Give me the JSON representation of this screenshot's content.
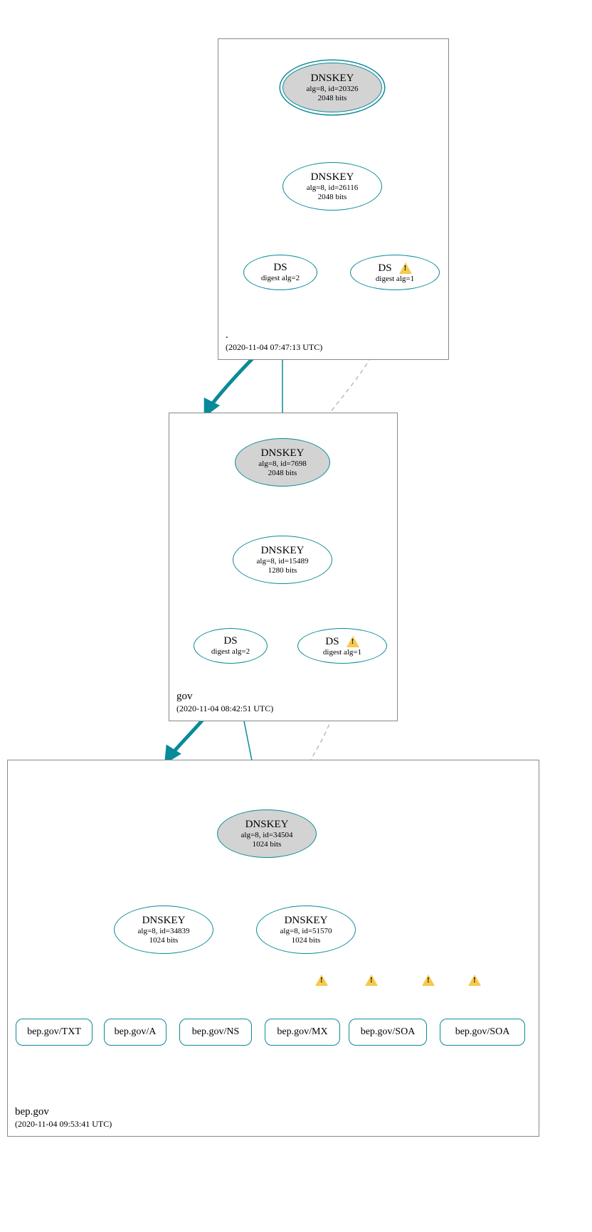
{
  "zones": {
    "root": {
      "name": ".",
      "timestamp": "(2020-11-04 07:47:13 UTC)"
    },
    "gov": {
      "name": "gov",
      "timestamp": "(2020-11-04 08:42:51 UTC)"
    },
    "bep": {
      "name": "bep.gov",
      "timestamp": "(2020-11-04 09:53:41 UTC)"
    }
  },
  "nodes": {
    "root_ksk": {
      "title": "DNSKEY",
      "line1": "alg=8, id=20326",
      "line2": "2048 bits"
    },
    "root_zsk": {
      "title": "DNSKEY",
      "line1": "alg=8, id=26116",
      "line2": "2048 bits"
    },
    "root_ds2": {
      "title": "DS",
      "line1": "digest alg=2"
    },
    "root_ds1": {
      "title": "DS",
      "line1": "digest alg=1"
    },
    "gov_ksk": {
      "title": "DNSKEY",
      "line1": "alg=8, id=7698",
      "line2": "2048 bits"
    },
    "gov_zsk": {
      "title": "DNSKEY",
      "line1": "alg=8, id=15489",
      "line2": "1280 bits"
    },
    "gov_ds2": {
      "title": "DS",
      "line1": "digest alg=2"
    },
    "gov_ds1": {
      "title": "DS",
      "line1": "digest alg=1"
    },
    "bep_ksk": {
      "title": "DNSKEY",
      "line1": "alg=8, id=34504",
      "line2": "1024 bits"
    },
    "bep_zsk1": {
      "title": "DNSKEY",
      "line1": "alg=8, id=34839",
      "line2": "1024 bits"
    },
    "bep_zsk2": {
      "title": "DNSKEY",
      "line1": "alg=8, id=51570",
      "line2": "1024 bits"
    },
    "rr_txt": {
      "label": "bep.gov/TXT"
    },
    "rr_a": {
      "label": "bep.gov/A"
    },
    "rr_ns": {
      "label": "bep.gov/NS"
    },
    "rr_mx": {
      "label": "bep.gov/MX"
    },
    "rr_soa1": {
      "label": "bep.gov/SOA"
    },
    "rr_soa2": {
      "label": "bep.gov/SOA"
    }
  }
}
